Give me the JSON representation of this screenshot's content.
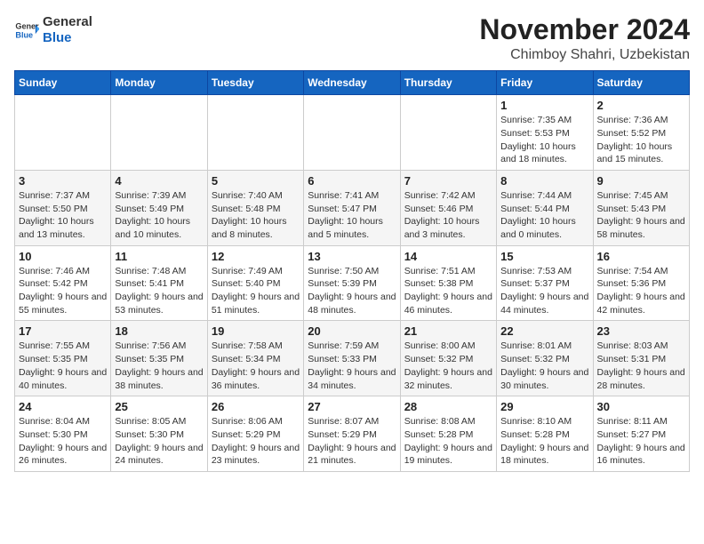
{
  "logo": {
    "general": "General",
    "blue": "Blue"
  },
  "title": "November 2024",
  "location": "Chimboy Shahri, Uzbekistan",
  "weekdays": [
    "Sunday",
    "Monday",
    "Tuesday",
    "Wednesday",
    "Thursday",
    "Friday",
    "Saturday"
  ],
  "weeks": [
    [
      {
        "day": "",
        "info": ""
      },
      {
        "day": "",
        "info": ""
      },
      {
        "day": "",
        "info": ""
      },
      {
        "day": "",
        "info": ""
      },
      {
        "day": "",
        "info": ""
      },
      {
        "day": "1",
        "info": "Sunrise: 7:35 AM\nSunset: 5:53 PM\nDaylight: 10 hours and 18 minutes."
      },
      {
        "day": "2",
        "info": "Sunrise: 7:36 AM\nSunset: 5:52 PM\nDaylight: 10 hours and 15 minutes."
      }
    ],
    [
      {
        "day": "3",
        "info": "Sunrise: 7:37 AM\nSunset: 5:50 PM\nDaylight: 10 hours and 13 minutes."
      },
      {
        "day": "4",
        "info": "Sunrise: 7:39 AM\nSunset: 5:49 PM\nDaylight: 10 hours and 10 minutes."
      },
      {
        "day": "5",
        "info": "Sunrise: 7:40 AM\nSunset: 5:48 PM\nDaylight: 10 hours and 8 minutes."
      },
      {
        "day": "6",
        "info": "Sunrise: 7:41 AM\nSunset: 5:47 PM\nDaylight: 10 hours and 5 minutes."
      },
      {
        "day": "7",
        "info": "Sunrise: 7:42 AM\nSunset: 5:46 PM\nDaylight: 10 hours and 3 minutes."
      },
      {
        "day": "8",
        "info": "Sunrise: 7:44 AM\nSunset: 5:44 PM\nDaylight: 10 hours and 0 minutes."
      },
      {
        "day": "9",
        "info": "Sunrise: 7:45 AM\nSunset: 5:43 PM\nDaylight: 9 hours and 58 minutes."
      }
    ],
    [
      {
        "day": "10",
        "info": "Sunrise: 7:46 AM\nSunset: 5:42 PM\nDaylight: 9 hours and 55 minutes."
      },
      {
        "day": "11",
        "info": "Sunrise: 7:48 AM\nSunset: 5:41 PM\nDaylight: 9 hours and 53 minutes."
      },
      {
        "day": "12",
        "info": "Sunrise: 7:49 AM\nSunset: 5:40 PM\nDaylight: 9 hours and 51 minutes."
      },
      {
        "day": "13",
        "info": "Sunrise: 7:50 AM\nSunset: 5:39 PM\nDaylight: 9 hours and 48 minutes."
      },
      {
        "day": "14",
        "info": "Sunrise: 7:51 AM\nSunset: 5:38 PM\nDaylight: 9 hours and 46 minutes."
      },
      {
        "day": "15",
        "info": "Sunrise: 7:53 AM\nSunset: 5:37 PM\nDaylight: 9 hours and 44 minutes."
      },
      {
        "day": "16",
        "info": "Sunrise: 7:54 AM\nSunset: 5:36 PM\nDaylight: 9 hours and 42 minutes."
      }
    ],
    [
      {
        "day": "17",
        "info": "Sunrise: 7:55 AM\nSunset: 5:35 PM\nDaylight: 9 hours and 40 minutes."
      },
      {
        "day": "18",
        "info": "Sunrise: 7:56 AM\nSunset: 5:35 PM\nDaylight: 9 hours and 38 minutes."
      },
      {
        "day": "19",
        "info": "Sunrise: 7:58 AM\nSunset: 5:34 PM\nDaylight: 9 hours and 36 minutes."
      },
      {
        "day": "20",
        "info": "Sunrise: 7:59 AM\nSunset: 5:33 PM\nDaylight: 9 hours and 34 minutes."
      },
      {
        "day": "21",
        "info": "Sunrise: 8:00 AM\nSunset: 5:32 PM\nDaylight: 9 hours and 32 minutes."
      },
      {
        "day": "22",
        "info": "Sunrise: 8:01 AM\nSunset: 5:32 PM\nDaylight: 9 hours and 30 minutes."
      },
      {
        "day": "23",
        "info": "Sunrise: 8:03 AM\nSunset: 5:31 PM\nDaylight: 9 hours and 28 minutes."
      }
    ],
    [
      {
        "day": "24",
        "info": "Sunrise: 8:04 AM\nSunset: 5:30 PM\nDaylight: 9 hours and 26 minutes."
      },
      {
        "day": "25",
        "info": "Sunrise: 8:05 AM\nSunset: 5:30 PM\nDaylight: 9 hours and 24 minutes."
      },
      {
        "day": "26",
        "info": "Sunrise: 8:06 AM\nSunset: 5:29 PM\nDaylight: 9 hours and 23 minutes."
      },
      {
        "day": "27",
        "info": "Sunrise: 8:07 AM\nSunset: 5:29 PM\nDaylight: 9 hours and 21 minutes."
      },
      {
        "day": "28",
        "info": "Sunrise: 8:08 AM\nSunset: 5:28 PM\nDaylight: 9 hours and 19 minutes."
      },
      {
        "day": "29",
        "info": "Sunrise: 8:10 AM\nSunset: 5:28 PM\nDaylight: 9 hours and 18 minutes."
      },
      {
        "day": "30",
        "info": "Sunrise: 8:11 AM\nSunset: 5:27 PM\nDaylight: 9 hours and 16 minutes."
      }
    ]
  ]
}
